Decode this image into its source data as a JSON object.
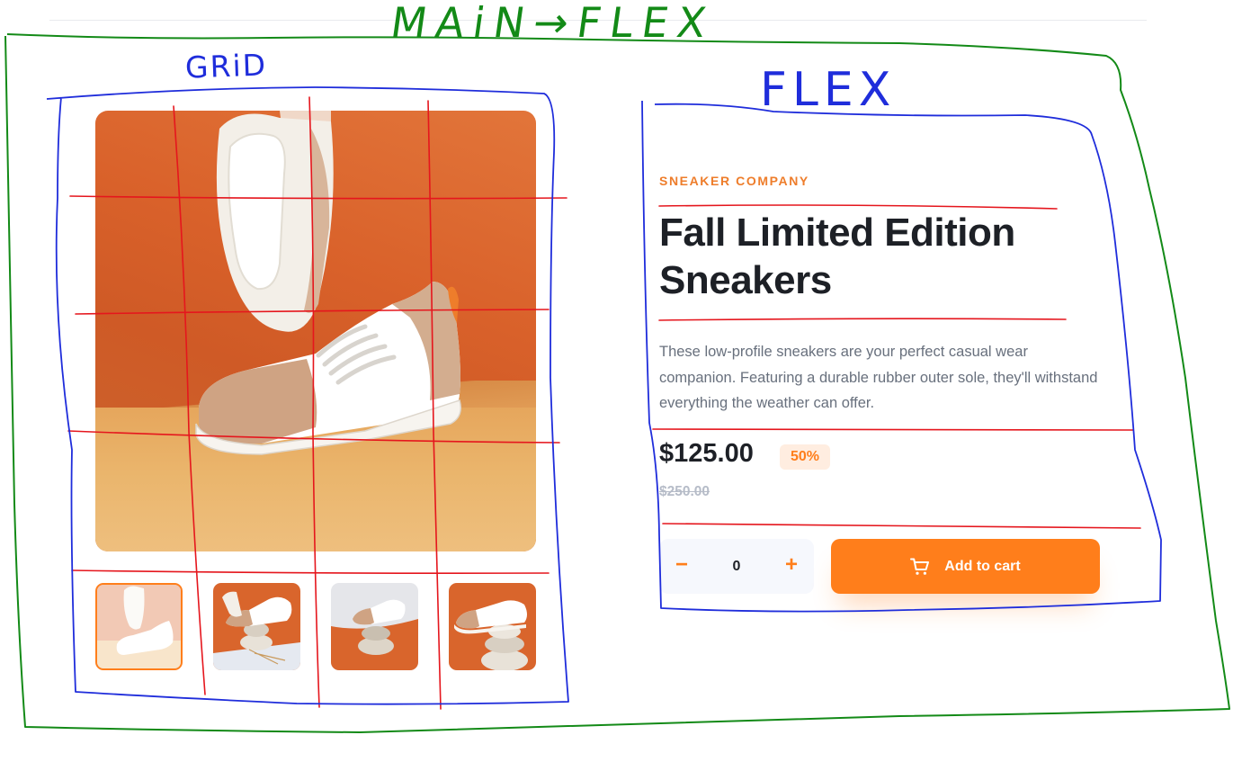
{
  "product": {
    "company": "SNEAKER COMPANY",
    "title": "Fall Limited Edition Sneakers",
    "description": "These low-profile sneakers are your perfect casual wear companion. Featuring a durable rubber outer sole, they'll withstand everything the weather can offer.",
    "price": "$125.00",
    "discount": "50%",
    "original_price": "$250.00"
  },
  "gallery": {
    "thumbnails": [
      "product-1",
      "product-2",
      "product-3",
      "product-4"
    ],
    "selected_index": 0
  },
  "cart": {
    "quantity": "0",
    "decrement_symbol": "−",
    "increment_symbol": "+",
    "add_label": "Add to cart",
    "icon": "cart-icon"
  },
  "annotations": {
    "main_label": "MAiN→FLEX",
    "grid_label": "GRiD",
    "flex_label": "FLEX"
  },
  "colors": {
    "accent": "#ff7e1b",
    "accent_pale": "#ffede0",
    "heading": "#1d2026",
    "text": "#68707d",
    "muted": "#b6bcc8",
    "annotation_green": "#138a17",
    "annotation_blue": "#1f2ddb",
    "annotation_red": "#e5161d"
  }
}
